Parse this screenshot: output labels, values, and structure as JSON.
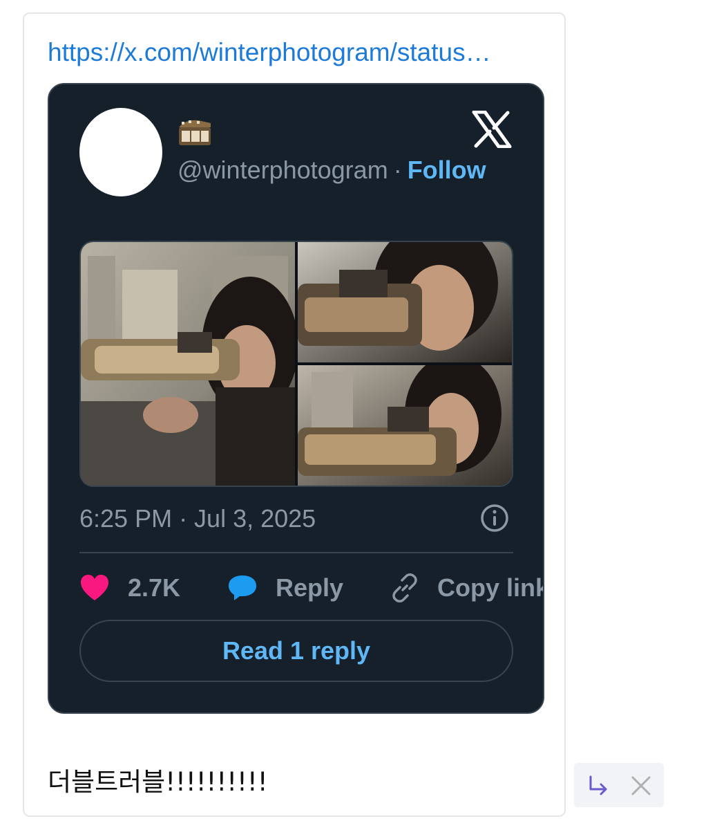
{
  "comment": {
    "link_url": "https://x.com/winterphotogram/status…",
    "text": "더블트러블!!!!!!!!!!"
  },
  "tweet": {
    "display_name_icon": "film-strip-emoji",
    "handle": "@winterphotogram",
    "separator": "·",
    "follow_label": "Follow",
    "timestamp": "6:25 PM · Jul 3, 2025",
    "likes_count": "2.7K",
    "reply_label": "Reply",
    "copy_link_label": "Copy link",
    "read_replies_label": "Read 1 reply",
    "media_count": 3
  },
  "icons": {
    "brand": "x-logo-icon",
    "info": "info-icon",
    "like": "heart-icon",
    "reply": "speech-bubble-icon",
    "copy": "link-icon",
    "comment_reply": "reply-arrow-icon",
    "comment_delete": "close-icon"
  },
  "colors": {
    "embed_background": "#15202b",
    "link_blue": "#1d7bd8",
    "follow_blue": "#5fb7f5",
    "heart_pink": "#f91880",
    "reply_blue": "#1d9bf0",
    "muted_text": "#8b98a5",
    "action_purple": "#6a5acd"
  }
}
